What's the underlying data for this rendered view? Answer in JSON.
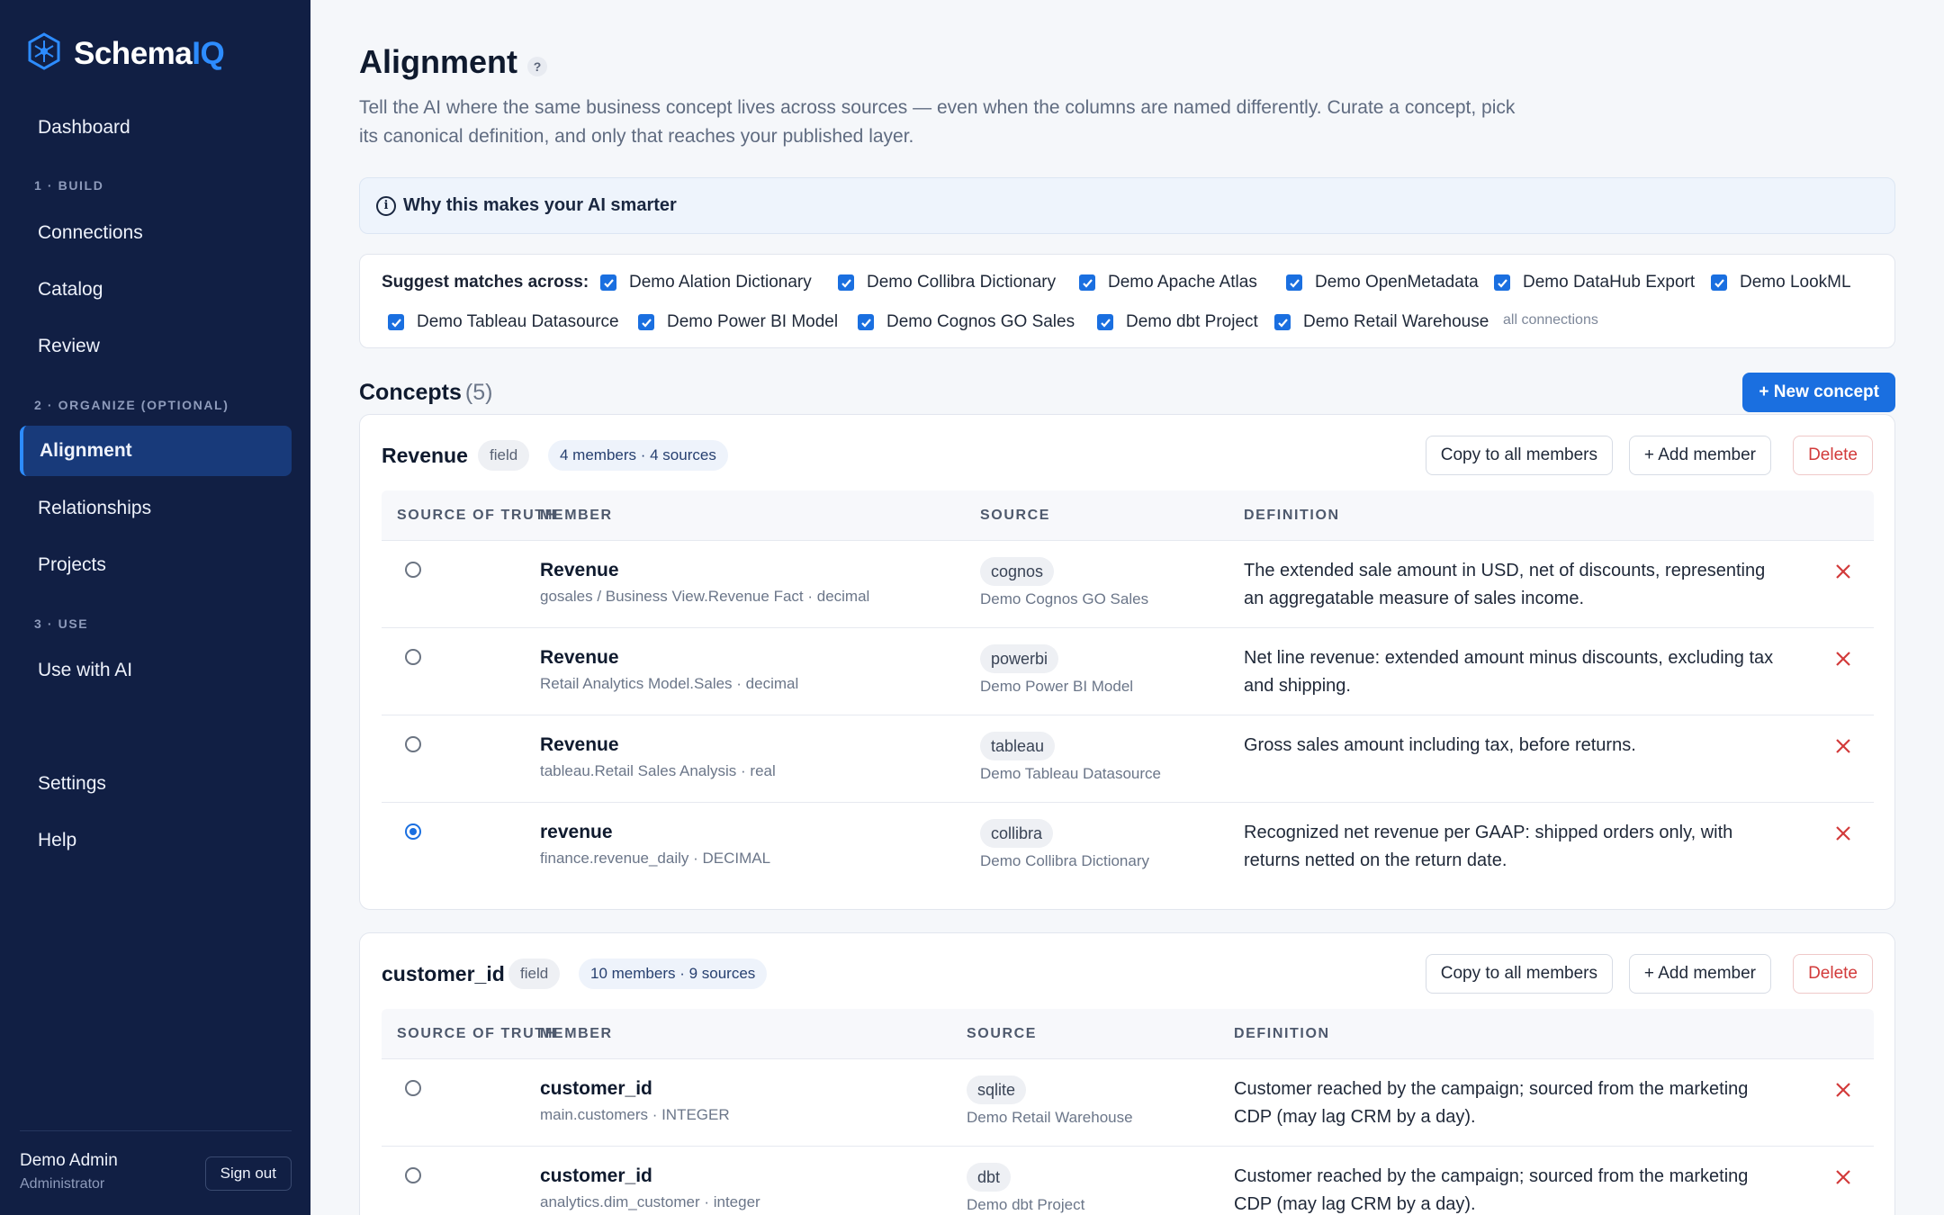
{
  "brand": {
    "name_a": "Schema",
    "name_b": "IQ"
  },
  "nav": {
    "dashboard": "Dashboard",
    "section_build": "1 · BUILD",
    "connections": "Connections",
    "catalog": "Catalog",
    "review": "Review",
    "section_organize": "2 · ORGANIZE (OPTIONAL)",
    "alignment": "Alignment",
    "relationships": "Relationships",
    "projects": "Projects",
    "section_use": "3 · USE",
    "use_with_ai": "Use with AI",
    "settings": "Settings",
    "help": "Help"
  },
  "user": {
    "name": "Demo Admin",
    "role": "Administrator",
    "sign_out": "Sign out"
  },
  "page": {
    "title": "Alignment",
    "help": "?",
    "subtitle": "Tell the AI where the same business concept lives across sources — even when the columns are named differently. Curate a concept, pick its canonical definition, and only that reaches your published layer.",
    "info": "Why this makes your AI smarter",
    "info_icon": "i"
  },
  "suggest": {
    "label": "Suggest matches across:",
    "sources": [
      "Demo Alation Dictionary",
      "Demo Collibra Dictionary",
      "Demo Apache Atlas",
      "Demo OpenMetadata",
      "Demo DataHub Export",
      "Demo LookML",
      "Demo Tableau Datasource",
      "Demo Power BI Model",
      "Demo Cognos GO Sales",
      "Demo dbt Project",
      "Demo Retail Warehouse"
    ],
    "all": "all connections"
  },
  "concepts": {
    "title": "Concepts",
    "count": "(5)",
    "new_button": "+ New concept",
    "headers": {
      "sot": "SOURCE OF TRUTH",
      "member": "MEMBER",
      "source": "SOURCE",
      "definition": "DEFINITION"
    },
    "actions": {
      "copy": "Copy to all members",
      "add": "+ Add member",
      "delete": "Delete"
    },
    "items": [
      {
        "name": "Revenue",
        "type": "field",
        "summary": "4 members · 4 sources",
        "rows": [
          {
            "member": "Revenue",
            "path": "gosales / Business View.Revenue Fact · decimal",
            "tag": "cognos",
            "source": "Demo Cognos GO Sales",
            "definition": "The extended sale amount in USD, net of discounts, representing an aggregatable measure of sales income.",
            "selected": false
          },
          {
            "member": "Revenue",
            "path": "Retail Analytics Model.Sales · decimal",
            "tag": "powerbi",
            "source": "Demo Power BI Model",
            "definition": "Net line revenue: extended amount minus discounts, excluding tax and shipping.",
            "selected": false
          },
          {
            "member": "Revenue",
            "path": "tableau.Retail Sales Analysis · real",
            "tag": "tableau",
            "source": "Demo Tableau Datasource",
            "definition": "Gross sales amount including tax, before returns.",
            "selected": false
          },
          {
            "member": "revenue",
            "path": "finance.revenue_daily · DECIMAL",
            "tag": "collibra",
            "source": "Demo Collibra Dictionary",
            "definition": "Recognized net revenue per GAAP: shipped orders only, with returns netted on the return date.",
            "selected": true
          }
        ]
      },
      {
        "name": "customer_id",
        "type": "field",
        "summary": "10 members · 9 sources",
        "rows": [
          {
            "member": "customer_id",
            "path": "main.customers · INTEGER",
            "tag": "sqlite",
            "source": "Demo Retail Warehouse",
            "definition": "Customer reached by the campaign; sourced from the marketing CDP (may lag CRM by a day).",
            "selected": false
          },
          {
            "member": "customer_id",
            "path": "analytics.dim_customer · integer",
            "tag": "dbt",
            "source": "Demo dbt Project",
            "definition": "Customer reached by the campaign; sourced from the marketing CDP (may lag CRM by a day).",
            "selected": false
          }
        ]
      }
    ]
  },
  "colors": {
    "sidebar": "#111f44",
    "accent": "#1a6fe0",
    "danger": "#d23a3a",
    "brand_iq": "#2d8cff"
  }
}
